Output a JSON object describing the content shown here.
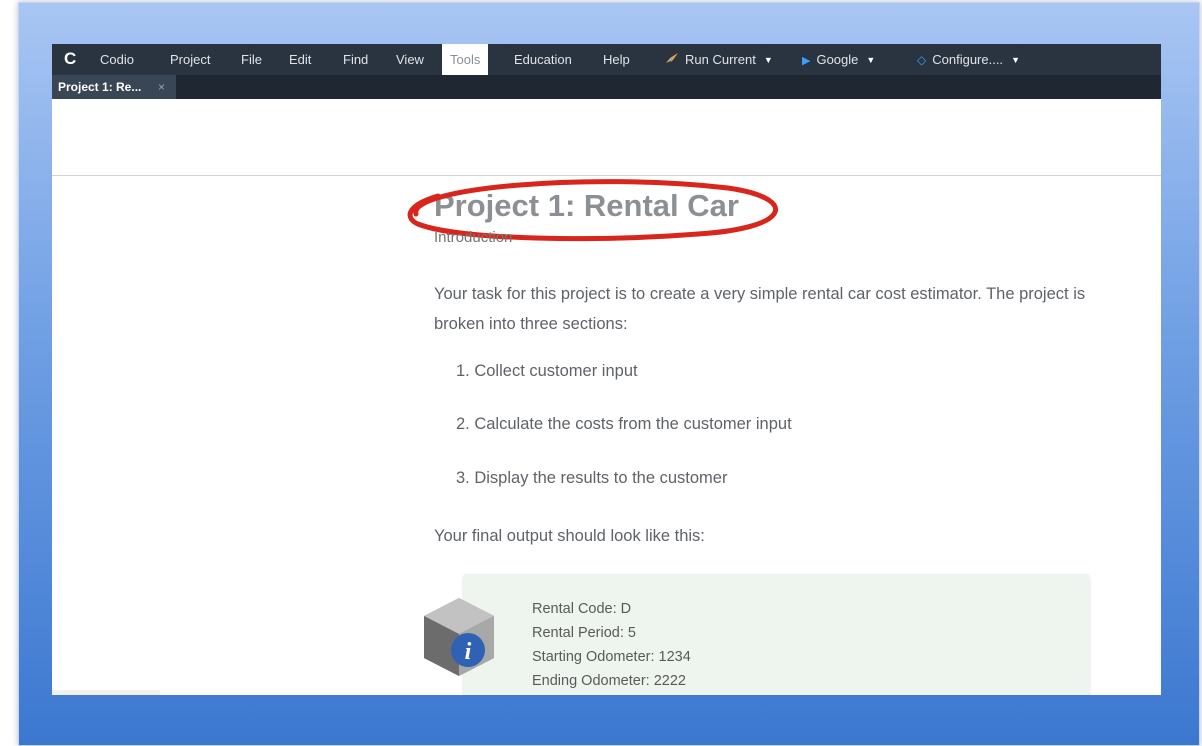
{
  "menubar": {
    "logo": "C",
    "items": [
      "Codio",
      "Project",
      "File",
      "Edit",
      "Find",
      "View",
      "Tools",
      "Education",
      "Help"
    ],
    "active": "Tools",
    "run_current": "Run Current",
    "google": "Google",
    "configure": "Configure...."
  },
  "tab": {
    "label": "Project 1: Re...",
    "close": "×"
  },
  "document": {
    "title": "Project 1: Rental Car",
    "subtitle": "Introduction",
    "intro": "Your task for this project is to create a very simple rental car cost estimator. The project is broken into three sections:",
    "list": [
      "1. Collect customer input",
      "2. Calculate the costs from the customer input",
      "3. Display the results to the customer"
    ],
    "final_output_heading": "Your final output should look like this:",
    "output_lines": [
      "Rental Code: D",
      "Rental Period: 5",
      "Starting Odometer: 1234",
      "Ending Odometer: 2222"
    ]
  },
  "colors": {
    "menubar": "#2a3441",
    "annotation_red": "#d8261c",
    "frame_gradient_top": "#a9c6f3",
    "frame_gradient_bottom": "#3c78d0",
    "output_box": "#eef4ee"
  },
  "icons": {
    "logo": "codio-logo-icon",
    "run": "rocket-icon",
    "google": "play-triangle-icon",
    "configure": "diamond-icon",
    "info": "info-hexagon-icon"
  }
}
